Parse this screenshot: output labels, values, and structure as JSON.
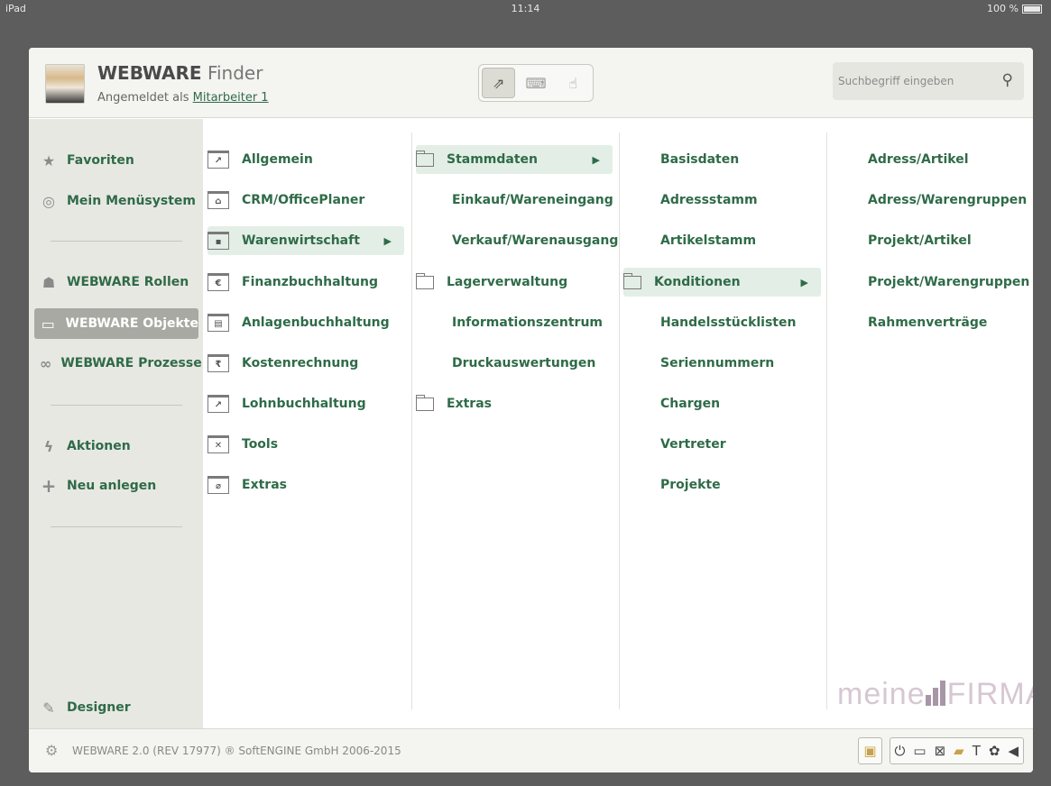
{
  "statusbar": {
    "device": "iPad",
    "time": "11:14",
    "battery": "100 %"
  },
  "header": {
    "app_name_bold": "WEBWARE",
    "app_name_thin": "Finder",
    "logged_prefix": "Angemeldet als",
    "user": "Mitarbeiter 1",
    "search_placeholder": "Suchbegriff eingeben"
  },
  "sidebar": {
    "items": [
      {
        "label": "Favoriten",
        "icon": "star-icon"
      },
      {
        "label": "Mein Menüsystem",
        "icon": "fingerprint-icon"
      },
      {
        "label": "WEBWARE Rollen",
        "icon": "people-icon"
      },
      {
        "label": "WEBWARE Objekte",
        "icon": "monitor-icon"
      },
      {
        "label": "WEBWARE Prozesse",
        "icon": "process-icon"
      },
      {
        "label": "Aktionen",
        "icon": "lightning-icon"
      },
      {
        "label": "Neu anlegen",
        "icon": "plus-icon"
      },
      {
        "label": "Designer",
        "icon": "brush-icon"
      }
    ]
  },
  "col1": [
    {
      "label": "Allgemein"
    },
    {
      "label": "CRM/OfficePlaner"
    },
    {
      "label": "Warenwirtschaft"
    },
    {
      "label": "Finanzbuchhaltung"
    },
    {
      "label": "Anlagenbuchhaltung"
    },
    {
      "label": "Kostenrechnung"
    },
    {
      "label": "Lohnbuchhaltung"
    },
    {
      "label": "Tools"
    },
    {
      "label": "Extras"
    }
  ],
  "col2": [
    {
      "label": "Stammdaten"
    },
    {
      "label": "Einkauf/Wareneingang"
    },
    {
      "label": "Verkauf/Warenausgang"
    },
    {
      "label": "Lagerverwaltung"
    },
    {
      "label": "Informationszentrum"
    },
    {
      "label": "Druckauswertungen"
    },
    {
      "label": "Extras"
    }
  ],
  "col3": [
    {
      "label": "Basisdaten"
    },
    {
      "label": "Adressstamm"
    },
    {
      "label": "Artikelstamm"
    },
    {
      "label": "Konditionen"
    },
    {
      "label": "Handelsstücklisten"
    },
    {
      "label": "Seriennummern"
    },
    {
      "label": "Chargen"
    },
    {
      "label": "Vertreter"
    },
    {
      "label": "Projekte"
    }
  ],
  "col4": [
    {
      "label": "Adress/Artikel"
    },
    {
      "label": "Adress/Warengruppen"
    },
    {
      "label": "Projekt/Artikel"
    },
    {
      "label": "Projekt/Warengruppen"
    },
    {
      "label": "Rahmenverträge"
    }
  ],
  "brand": {
    "text_thin": "meine",
    "text_bold": "FIRMA"
  },
  "footer": {
    "copyright": "WEBWARE 2.0 (REV 17977) ® SoftENGINE GmbH 2006-2015"
  },
  "colors": {
    "accent": "#2f6b48",
    "selected_bg": "#e3eee6",
    "sidebar_bg": "#e8e8e3"
  }
}
